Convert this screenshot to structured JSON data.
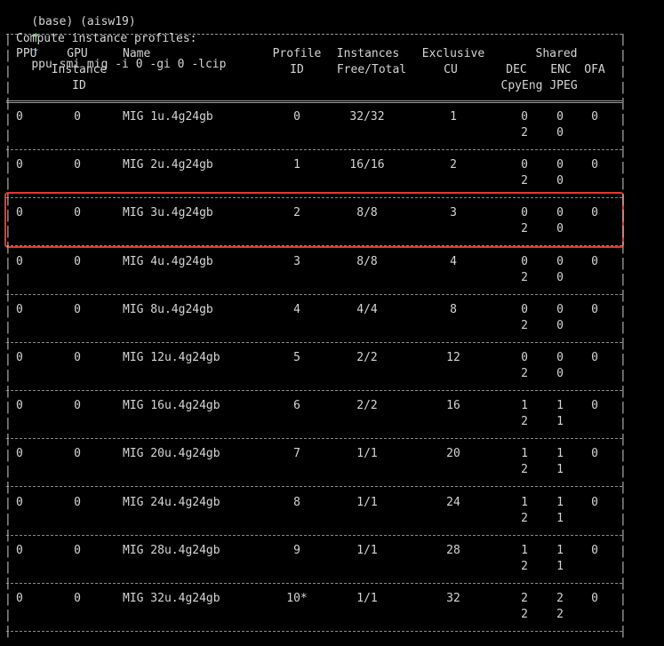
{
  "command": {
    "prompt": "(base) (aisw19)",
    "arrow": "➜",
    "dir": "~",
    "text": "ppu-smi mig -i 0 -gi 0 -lcip"
  },
  "table": {
    "title": "Compute instance profiles:",
    "headers": {
      "ppu": "PPU",
      "gpu": "GPU",
      "instance": "Instance",
      "id": "ID",
      "name": "Name",
      "profile": "Profile",
      "profile_id": "ID",
      "instances": "Instances",
      "free_total": "Free/Total",
      "exclusive": "Exclusive",
      "cu": "CU",
      "shared": "Shared",
      "dec": "DEC",
      "enc": "ENC",
      "ofa": "OFA",
      "cpyeng": "CpyEng",
      "jpeg": "JPEG"
    },
    "rows": [
      {
        "ppu": "0",
        "gpu": "0",
        "name": "MIG 1u.4g24gb",
        "profile_id": "0",
        "free_total": "32/32",
        "cu": "1",
        "dec": "0",
        "enc": "0",
        "ofa": "0",
        "cpyeng": "2",
        "jpeg": "0"
      },
      {
        "ppu": "0",
        "gpu": "0",
        "name": "MIG 2u.4g24gb",
        "profile_id": "1",
        "free_total": "16/16",
        "cu": "2",
        "dec": "0",
        "enc": "0",
        "ofa": "0",
        "cpyeng": "2",
        "jpeg": "0"
      },
      {
        "ppu": "0",
        "gpu": "0",
        "name": "MIG 3u.4g24gb",
        "profile_id": "2",
        "free_total": "8/8",
        "cu": "3",
        "dec": "0",
        "enc": "0",
        "ofa": "0",
        "cpyeng": "2",
        "jpeg": "0"
      },
      {
        "ppu": "0",
        "gpu": "0",
        "name": "MIG 4u.4g24gb",
        "profile_id": "3",
        "free_total": "8/8",
        "cu": "4",
        "dec": "0",
        "enc": "0",
        "ofa": "0",
        "cpyeng": "2",
        "jpeg": "0"
      },
      {
        "ppu": "0",
        "gpu": "0",
        "name": "MIG 8u.4g24gb",
        "profile_id": "4",
        "free_total": "4/4",
        "cu": "8",
        "dec": "0",
        "enc": "0",
        "ofa": "0",
        "cpyeng": "2",
        "jpeg": "0"
      },
      {
        "ppu": "0",
        "gpu": "0",
        "name": "MIG 12u.4g24gb",
        "profile_id": "5",
        "free_total": "2/2",
        "cu": "12",
        "dec": "0",
        "enc": "0",
        "ofa": "0",
        "cpyeng": "2",
        "jpeg": "0"
      },
      {
        "ppu": "0",
        "gpu": "0",
        "name": "MIG 16u.4g24gb",
        "profile_id": "6",
        "free_total": "2/2",
        "cu": "16",
        "dec": "1",
        "enc": "1",
        "ofa": "0",
        "cpyeng": "2",
        "jpeg": "1"
      },
      {
        "ppu": "0",
        "gpu": "0",
        "name": "MIG 20u.4g24gb",
        "profile_id": "7",
        "free_total": "1/1",
        "cu": "20",
        "dec": "1",
        "enc": "1",
        "ofa": "0",
        "cpyeng": "2",
        "jpeg": "1"
      },
      {
        "ppu": "0",
        "gpu": "0",
        "name": "MIG 24u.4g24gb",
        "profile_id": "8",
        "free_total": "1/1",
        "cu": "24",
        "dec": "1",
        "enc": "1",
        "ofa": "0",
        "cpyeng": "2",
        "jpeg": "1"
      },
      {
        "ppu": "0",
        "gpu": "0",
        "name": "MIG 28u.4g24gb",
        "profile_id": "9",
        "free_total": "1/1",
        "cu": "28",
        "dec": "1",
        "enc": "1",
        "ofa": "0",
        "cpyeng": "2",
        "jpeg": "1"
      },
      {
        "ppu": "0",
        "gpu": "0",
        "name": "MIG 32u.4g24gb",
        "profile_id": "10*",
        "free_total": "1/1",
        "cu": "32",
        "dec": "2",
        "enc": "2",
        "ofa": "0",
        "cpyeng": "2",
        "jpeg": "2"
      }
    ]
  },
  "colors": {
    "background": "#000000",
    "text": "#d4d4d4",
    "arrow": "#5fd75f",
    "highlight": "#e5392c"
  }
}
